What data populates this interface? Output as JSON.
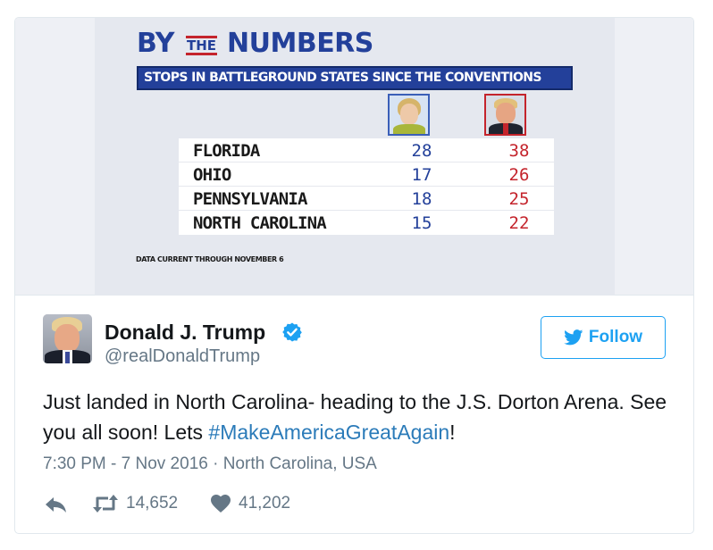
{
  "graphic": {
    "title_by": "BY",
    "title_the": "THE",
    "title_numbers": "NUMBERS",
    "subtitle": "STOPS IN BATTLEGROUND STATES SINCE THE CONVENTIONS",
    "rows": [
      {
        "state": "FLORIDA",
        "clinton": "28",
        "trump": "38"
      },
      {
        "state": "OHIO",
        "clinton": "17",
        "trump": "26"
      },
      {
        "state": "PENNSYLVANIA",
        "clinton": "18",
        "trump": "25"
      },
      {
        "state": "NORTH CAROLINA",
        "clinton": "15",
        "trump": "22"
      }
    ],
    "source_note": "DATA CURRENT THROUGH NOVEMBER 6",
    "colors": {
      "blue": "#23409a",
      "red": "#c4242c"
    }
  },
  "tweet": {
    "display_name": "Donald J. Trump",
    "screen_name": "@realDonaldTrump",
    "verified_icon": "verified-badge-icon",
    "follow_label": "Follow",
    "text_part1": "Just landed in North Carolina- heading to the J.S. Dorton Arena. See you all soon! Lets ",
    "hashtag": "#MakeAmericaGreatAgain",
    "text_part2": "!",
    "timestamp": "7:30 PM - 7 Nov 2016 · North Carolina, USA",
    "retweets": "14,652",
    "likes": "41,202",
    "colors": {
      "link": "#1da1f2",
      "muted": "#657786",
      "hashtag": "#2b7bb9"
    }
  }
}
